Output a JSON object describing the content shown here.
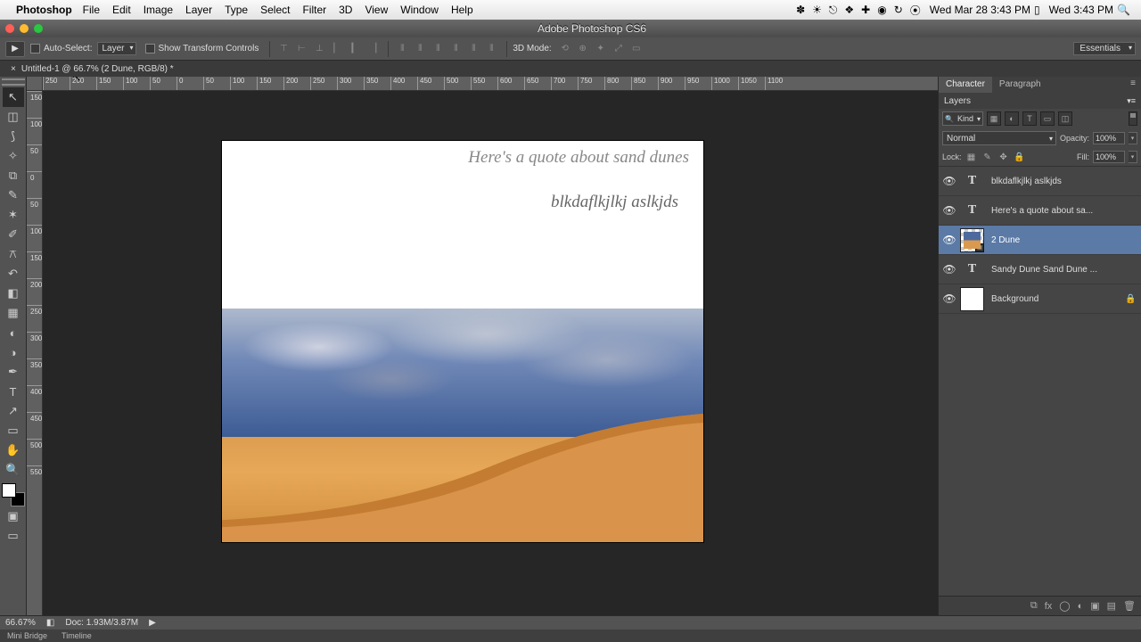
{
  "mac_menu": {
    "app": "Photoshop",
    "items": [
      "File",
      "Edit",
      "Image",
      "Layer",
      "Type",
      "Select",
      "Filter",
      "3D",
      "View",
      "Window",
      "Help"
    ],
    "clock": "Wed Mar 28  3:43 PM",
    "clock2": "Wed 3:43 PM"
  },
  "window": {
    "title": "Adobe Photoshop CS6"
  },
  "options": {
    "auto_select": "Auto-Select:",
    "auto_select_target": "Layer",
    "show_transform": "Show Transform Controls",
    "mode3d": "3D Mode:",
    "workspace": "Essentials"
  },
  "doc_tab": {
    "label": "Untitled-1 @ 66.7% (2 Dune, RGB/8) *"
  },
  "ruler_h": [
    "250",
    "200",
    "150",
    "100",
    "50",
    "0",
    "50",
    "100",
    "150",
    "200",
    "250",
    "300",
    "350",
    "400",
    "450",
    "500",
    "550",
    "600",
    "650",
    "700",
    "750",
    "800",
    "850",
    "900",
    "950",
    "1000",
    "1050",
    "1100"
  ],
  "ruler_v": [
    "150",
    "100",
    "50",
    "0",
    "50",
    "100",
    "150",
    "200",
    "250",
    "300",
    "350",
    "400",
    "450",
    "500",
    "550"
  ],
  "canvas": {
    "text1": "Here's a quote about sand dunes",
    "text2": "blkdaflkjlkj aslkjds"
  },
  "panels": {
    "char_tab": "Character",
    "para_tab": "Paragraph",
    "layers_tab": "Layers",
    "filter_kind": "Kind",
    "blend_mode": "Normal",
    "opacity_label": "Opacity:",
    "opacity_val": "100%",
    "lock_label": "Lock:",
    "fill_label": "Fill:",
    "fill_val": "100%"
  },
  "layers": [
    {
      "type": "text",
      "name": "blkdaflkjlkj aslkjds",
      "selected": false
    },
    {
      "type": "text",
      "name": "Here's a quote about sa...",
      "selected": false
    },
    {
      "type": "smart",
      "name": "2 Dune",
      "selected": true
    },
    {
      "type": "text",
      "name": "Sandy Dune Sand Dune ...",
      "selected": false
    },
    {
      "type": "bg",
      "name": "Background",
      "selected": false,
      "locked": true
    }
  ],
  "status": {
    "zoom": "66.67%",
    "doc": "Doc: 1.93M/3.87M"
  },
  "bottom_tabs": {
    "a": "Mini Bridge",
    "b": "Timeline"
  }
}
